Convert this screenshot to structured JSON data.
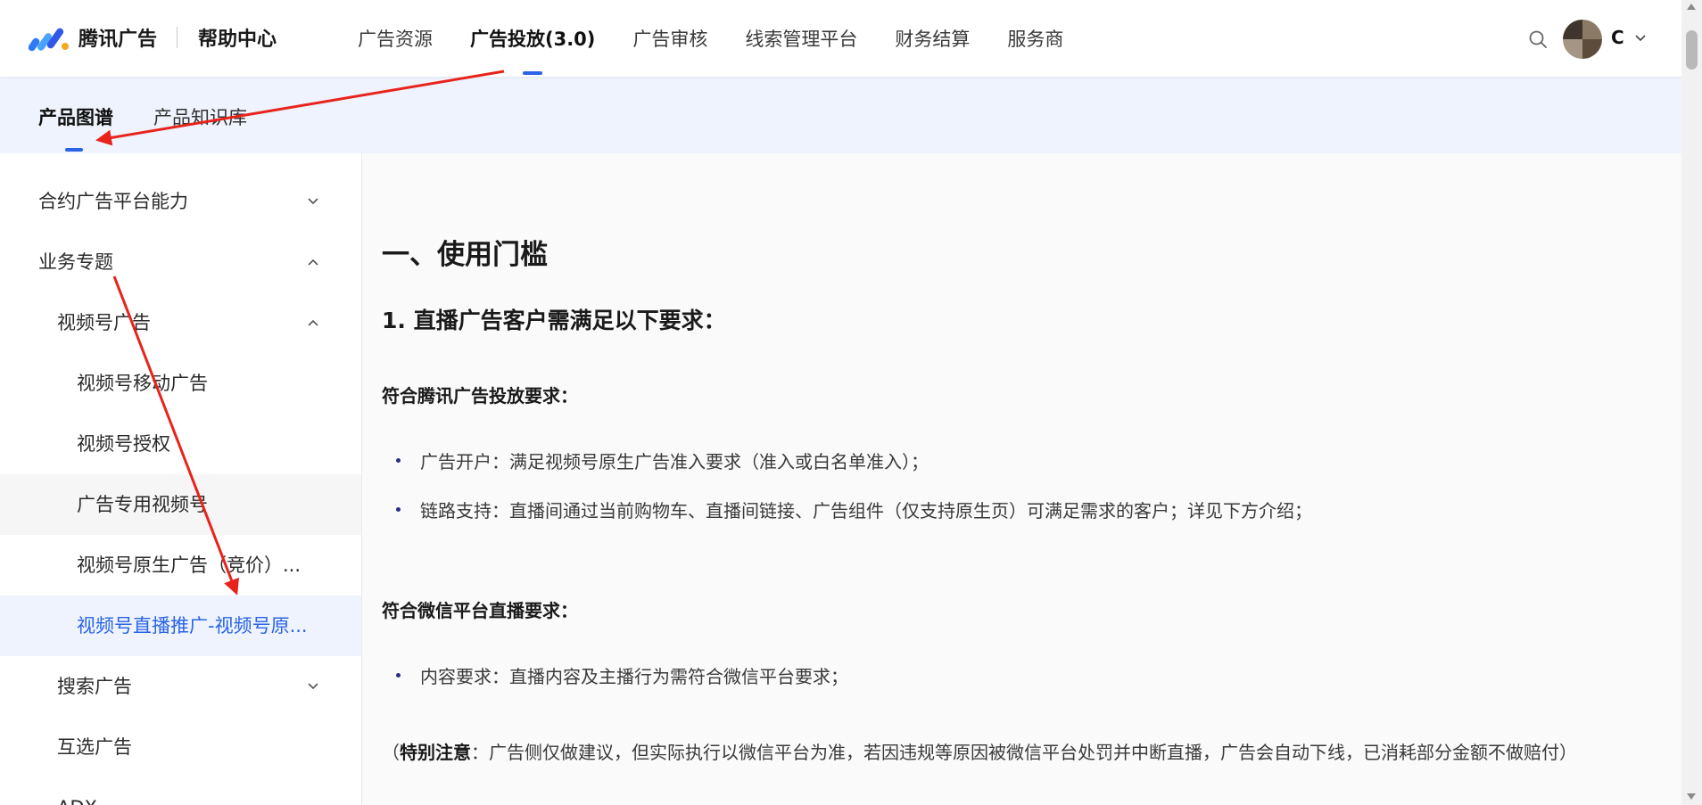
{
  "header": {
    "brand": "腾讯广告",
    "help_center": "帮助中心",
    "nav": [
      {
        "label": "广告资源",
        "active": false
      },
      {
        "label": "广告投放(3.0)",
        "active": true
      },
      {
        "label": "广告审核",
        "active": false
      },
      {
        "label": "线索管理平台",
        "active": false
      },
      {
        "label": "财务结算",
        "active": false
      },
      {
        "label": "服务商",
        "active": false
      }
    ],
    "user_initial": "C"
  },
  "subnav": {
    "tabs": [
      {
        "label": "产品图谱",
        "active": true
      },
      {
        "label": "产品知识库",
        "active": false
      }
    ]
  },
  "sidebar": {
    "items": [
      {
        "label": "合约广告平台能力",
        "level": 0,
        "expand": "down"
      },
      {
        "label": "业务专题",
        "level": 0,
        "expand": "up"
      },
      {
        "label": "视频号广告",
        "level": 1,
        "expand": "up"
      },
      {
        "label": "视频号移动广告",
        "level": 2
      },
      {
        "label": "视频号授权",
        "level": 2
      },
      {
        "label": "广告专用视频号",
        "level": 2,
        "state": "hover"
      },
      {
        "label": "视频号原生广告（竞价）...",
        "level": 2
      },
      {
        "label": "视频号直播推广-视频号原...",
        "level": 2,
        "state": "selected"
      },
      {
        "label": "搜索广告",
        "level": 1,
        "expand": "down"
      },
      {
        "label": "互选广告",
        "level": 1
      },
      {
        "label": "ADX",
        "level": 1
      }
    ]
  },
  "content": {
    "h1": "一、使用门槛",
    "h2": "1. 直播广告客户需满足以下要求：",
    "section1_title": "符合腾讯广告投放要求：",
    "section1_bullets": [
      "广告开户：满足视频号原生广告准入要求（准入或白名单准入）；",
      "链路支持：直播间通过当前购物车、直播间链接、广告组件（仅支持原生页）可满足需求的客户；详见下方介绍；"
    ],
    "section2_title": "符合微信平台直播要求：",
    "section2_bullets": [
      "内容要求：直播内容及主播行为需符合微信平台要求；"
    ],
    "note_prefix": "（",
    "note_bold": "特别注意",
    "note_text": "：广告侧仅做建议，但实际执行以微信平台为准，若因违规等原因被微信平台处罚并中断直播，广告会自动下线，已消耗部分金额不做赔付）"
  },
  "colors": {
    "accent": "#2a63e6",
    "subbar_bg": "#eef3fd",
    "annotation_arrow": "#e8231b"
  },
  "icons": [
    "logo-icon",
    "search-icon",
    "avatar",
    "chevron-down-icon",
    "chevron-up-icon"
  ]
}
